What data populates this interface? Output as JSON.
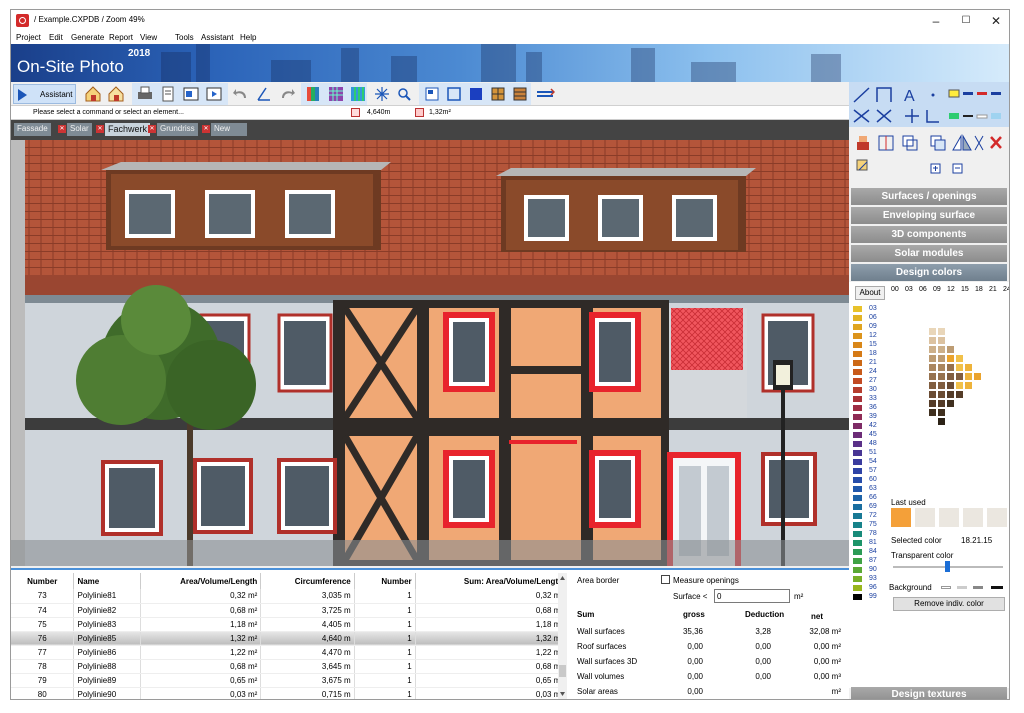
{
  "window": {
    "title": "/ Example.CXPDB / Zoom 49%",
    "controls": {
      "minimize": "–",
      "maximize": "☐",
      "close": "✕"
    }
  },
  "menu": [
    "Project",
    "Edit",
    "Generate",
    "Report",
    "View",
    "Tools",
    "Assistant",
    "Help"
  ],
  "banner": {
    "brand": "On-Site Photo",
    "year": "2018"
  },
  "toolbar": {
    "assistant_label": "Assistant"
  },
  "status": {
    "message": "Please select a command or select an element...",
    "length": "4,640m",
    "area": "1,32m²"
  },
  "tabs": [
    {
      "label": "Fassade",
      "active": false
    },
    {
      "label": "Solar",
      "active": false
    },
    {
      "label": "Fachwerk",
      "active": true
    },
    {
      "label": "Grundriss",
      "active": false
    },
    {
      "label": "New",
      "active": false
    }
  ],
  "table": {
    "headers": [
      "Number",
      "Name",
      "Area/Volume/Length",
      "Circumference",
      "Number",
      "Sum:  Area/Volume/Length"
    ],
    "rows": [
      [
        "73",
        "Polylinie81",
        "0,32 m²",
        "3,035 m",
        "1",
        "0,32 m²"
      ],
      [
        "74",
        "Polylinie82",
        "0,68 m²",
        "3,725 m",
        "1",
        "0,68 m²"
      ],
      [
        "75",
        "Polylinie83",
        "1,18 m²",
        "4,405 m",
        "1",
        "1,18 m²"
      ],
      [
        "76",
        "Polylinie85",
        "1,32 m²",
        "4,640 m",
        "1",
        "1,32 m²"
      ],
      [
        "77",
        "Polylinie86",
        "1,22 m²",
        "4,470 m",
        "1",
        "1,22 m²"
      ],
      [
        "78",
        "Polylinie88",
        "0,68 m²",
        "3,645 m",
        "1",
        "0,68 m²"
      ],
      [
        "79",
        "Polylinie89",
        "0,65 m²",
        "3,675 m",
        "1",
        "0,65 m²"
      ],
      [
        "80",
        "Polylinie90",
        "0,03 m²",
        "0,715 m",
        "1",
        "0,03 m²"
      ]
    ],
    "selected_row": 3
  },
  "summary": {
    "area_border": "Area border",
    "measure_openings": "Measure openings",
    "surface_label": "Surface <",
    "surface_value": "0",
    "surface_unit": "m²",
    "col_sum": "Sum",
    "col_gross": "gross",
    "col_deduction": "Deduction",
    "col_net": "net",
    "rows": [
      {
        "label": "Wall surfaces",
        "gross": "35,36",
        "deduction": "3,28",
        "net": "32,08 m²"
      },
      {
        "label": "Roof surfaces",
        "gross": "0,00",
        "deduction": "0,00",
        "net": "0,00 m²"
      },
      {
        "label": "Wall surfaces 3D",
        "gross": "0,00",
        "deduction": "0,00",
        "net": "0,00 m²"
      },
      {
        "label": "Wall volumes",
        "gross": "0,00",
        "deduction": "0,00",
        "net": "0,00 m³"
      },
      {
        "label": "Solar areas",
        "gross": "0,00",
        "deduction": "",
        "net": "m²"
      }
    ]
  },
  "panel": {
    "sections": [
      "Surfaces / openings",
      "Enveloping surface",
      "3D components",
      "Solar modules",
      "Design colors"
    ],
    "about": "About",
    "columns": [
      "00",
      "03",
      "06",
      "09",
      "12",
      "15",
      "18",
      "21",
      "24"
    ],
    "color_numbers": [
      "03",
      "06",
      "09",
      "12",
      "15",
      "18",
      "21",
      "24",
      "27",
      "30",
      "33",
      "36",
      "39",
      "42",
      "45",
      "48",
      "51",
      "54",
      "57",
      "60",
      "63",
      "66",
      "69",
      "72",
      "75",
      "78",
      "81",
      "84",
      "87",
      "90",
      "93",
      "96",
      "99"
    ],
    "color_swatches": [
      "#e8c22a",
      "#e2b425",
      "#e0a520",
      "#dc941c",
      "#d98718",
      "#d57a16",
      "#cc6815",
      "#c85a1a",
      "#c24a23",
      "#b63d2e",
      "#a93237",
      "#9e2d44",
      "#8f2b55",
      "#7e2b66",
      "#6c2c77",
      "#5a3088",
      "#483594",
      "#3a3b9e",
      "#2e43a6",
      "#274daa",
      "#2158ac",
      "#1d63a8",
      "#1a6ea0",
      "#187995",
      "#17838a",
      "#188b7a",
      "#1c9468",
      "#2b9b55",
      "#3fa244",
      "#5aa935",
      "#78b028",
      "#98b61c",
      "#000000"
    ],
    "last_used": "Last used",
    "selected_color_label": "Selected color",
    "selected_color_value": "18.21.15",
    "transparent_color": "Transparent color",
    "background": "Background",
    "remove_button": "Remove indiv. color",
    "design_textures": "Design textures",
    "accent": "#f4a039"
  }
}
